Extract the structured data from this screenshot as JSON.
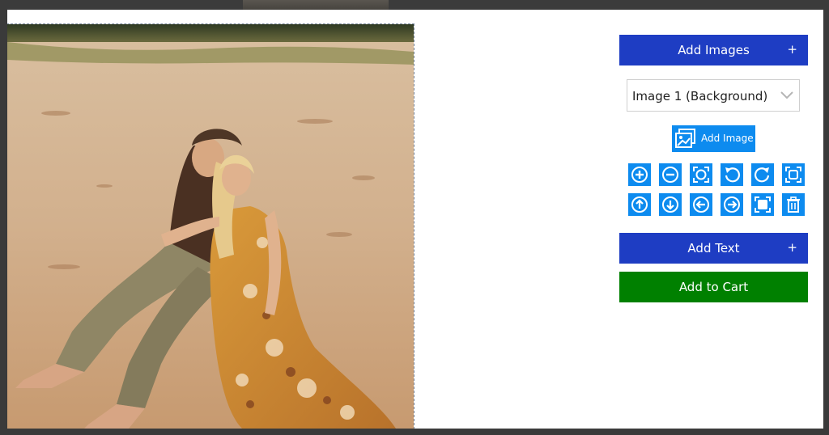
{
  "controls": {
    "add_images": {
      "label": "Add Images",
      "plus": "+"
    },
    "image_select": {
      "selected": "Image 1 (Background)"
    },
    "add_image_button": {
      "label": "Add Image"
    },
    "add_text": {
      "label": "Add Text",
      "plus": "+"
    },
    "add_to_cart": {
      "label": "Add to Cart"
    }
  },
  "tools_row1": [
    "zoom-in-icon",
    "zoom-out-icon",
    "fit-icon",
    "rotate-left-icon",
    "rotate-right-icon",
    "fill-icon"
  ],
  "tools_row2": [
    "move-up-icon",
    "move-down-icon",
    "move-left-icon",
    "move-right-icon",
    "center-icon",
    "delete-icon"
  ],
  "colors": {
    "accent_blue": "#1e3dc3",
    "tool_blue": "#0d8bef",
    "cart_green": "#008000"
  }
}
